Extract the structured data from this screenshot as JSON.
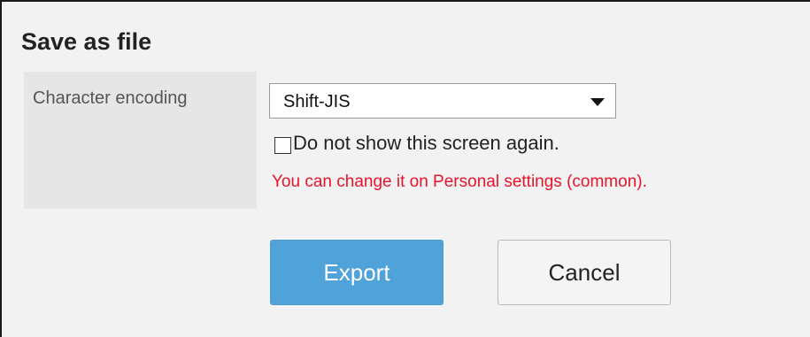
{
  "dialog": {
    "title": "Save as file"
  },
  "form": {
    "encoding_label": "Character encoding",
    "encoding_selected": "Shift-JIS",
    "dont_show_again_label": "Do not show this screen again.",
    "dont_show_again_checked": false,
    "settings_note": "You can change it on Personal settings (common).",
    "note_color": "#e8142a"
  },
  "buttons": {
    "export_label": "Export",
    "cancel_label": "Cancel",
    "export_color": "#4fa3d9"
  }
}
